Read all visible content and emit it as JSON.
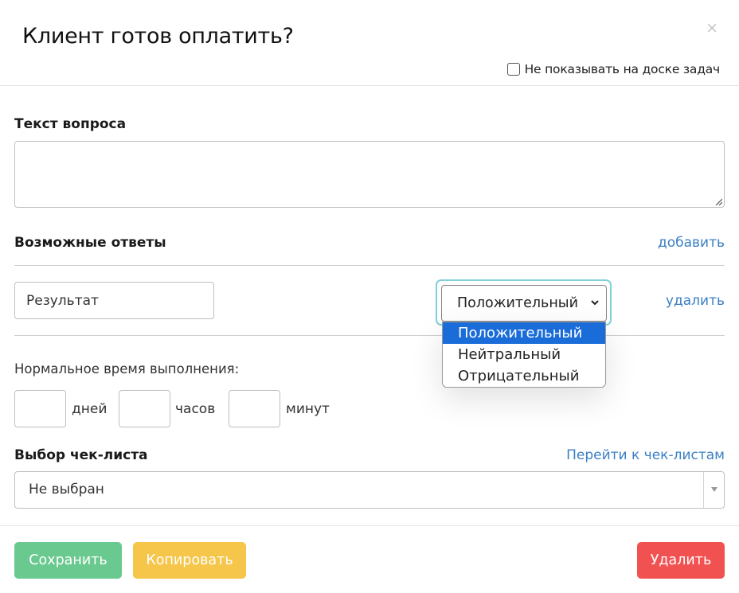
{
  "modal": {
    "title": "Клиент готов оплатить?",
    "close_label": "×",
    "hide_on_board_label": "Не показывать на доске задач",
    "hide_on_board_checked": false
  },
  "question": {
    "label": "Текст вопроса",
    "value": ""
  },
  "answers": {
    "label": "Возможные ответы",
    "add_label": "добавить",
    "items": [
      {
        "text": "Результат",
        "type_selected": "Положительный",
        "delete_label": "удалить"
      }
    ],
    "type_options": [
      "Положительный",
      "Нейтральный",
      "Отрицательный"
    ]
  },
  "normal_time": {
    "label": "Нормальное время выполнения:",
    "days_label": "дней",
    "hours_label": "часов",
    "minutes_label": "минут",
    "days": "",
    "hours": "",
    "minutes": ""
  },
  "checklist": {
    "label": "Выбор чек-листа",
    "goto_label": "Перейти к чек-листам",
    "selected": "Не выбран"
  },
  "footer": {
    "save_label": "Сохранить",
    "copy_label": "Копировать",
    "delete_label": "Удалить"
  },
  "colors": {
    "save": "#69c98f",
    "copy": "#f6c64a",
    "delete": "#f25152",
    "link": "#3b7fc4",
    "option_selected": "#1a6dd9",
    "focus_ring": "#7fd0d8"
  }
}
